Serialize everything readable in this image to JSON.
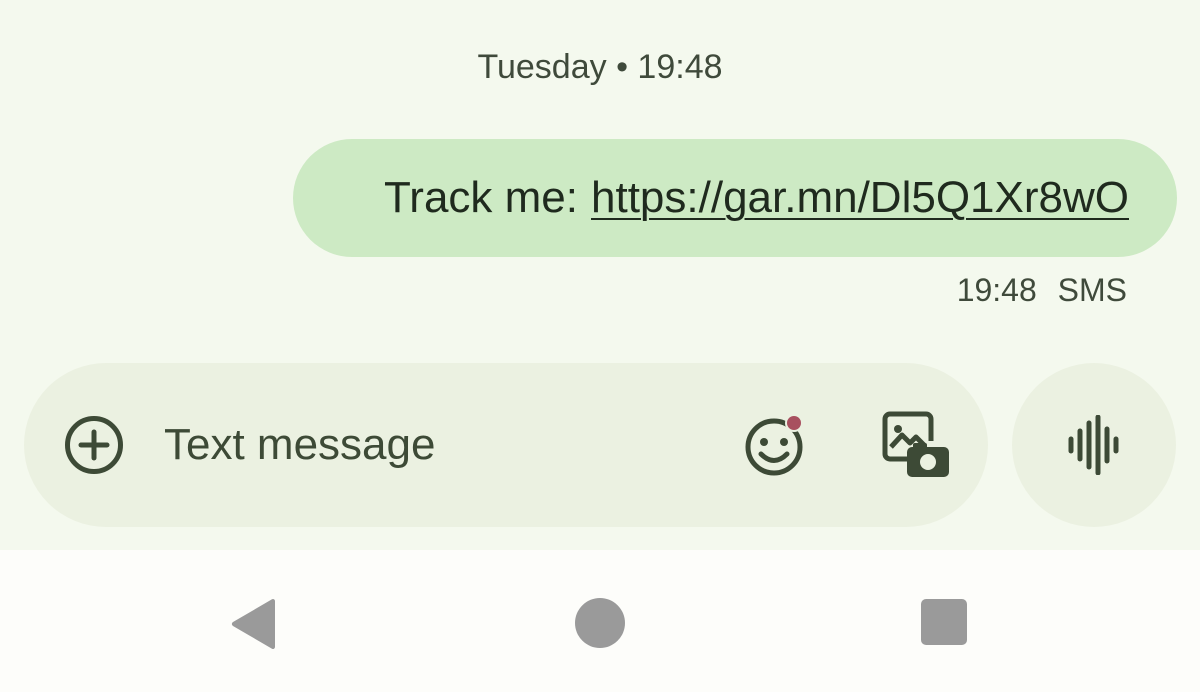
{
  "conversation": {
    "date_header": "Tuesday • 19:48",
    "message": {
      "prefix": "Track me:",
      "link": "https://gar.mn/Dl5Q1Xr8wO",
      "time": "19:48",
      "type": "SMS"
    }
  },
  "compose": {
    "placeholder": "Text message",
    "value": "",
    "icons": {
      "add": "add-circle-icon",
      "emoji": "emoji-icon",
      "gallery": "gallery-camera-icon",
      "voice": "voice-waveform-icon"
    },
    "emoji_badge_color": "#a8505f"
  },
  "navbar": {
    "icons": [
      "back-icon",
      "home-icon",
      "recents-icon"
    ]
  },
  "colors": {
    "background": "#f4f9ee",
    "bubble": "#cdeac4",
    "compose_bg": "#ebf1e1",
    "text": "#1f2a1e",
    "icon": "#3d4a36",
    "nav_icon": "#9a9a9a"
  }
}
